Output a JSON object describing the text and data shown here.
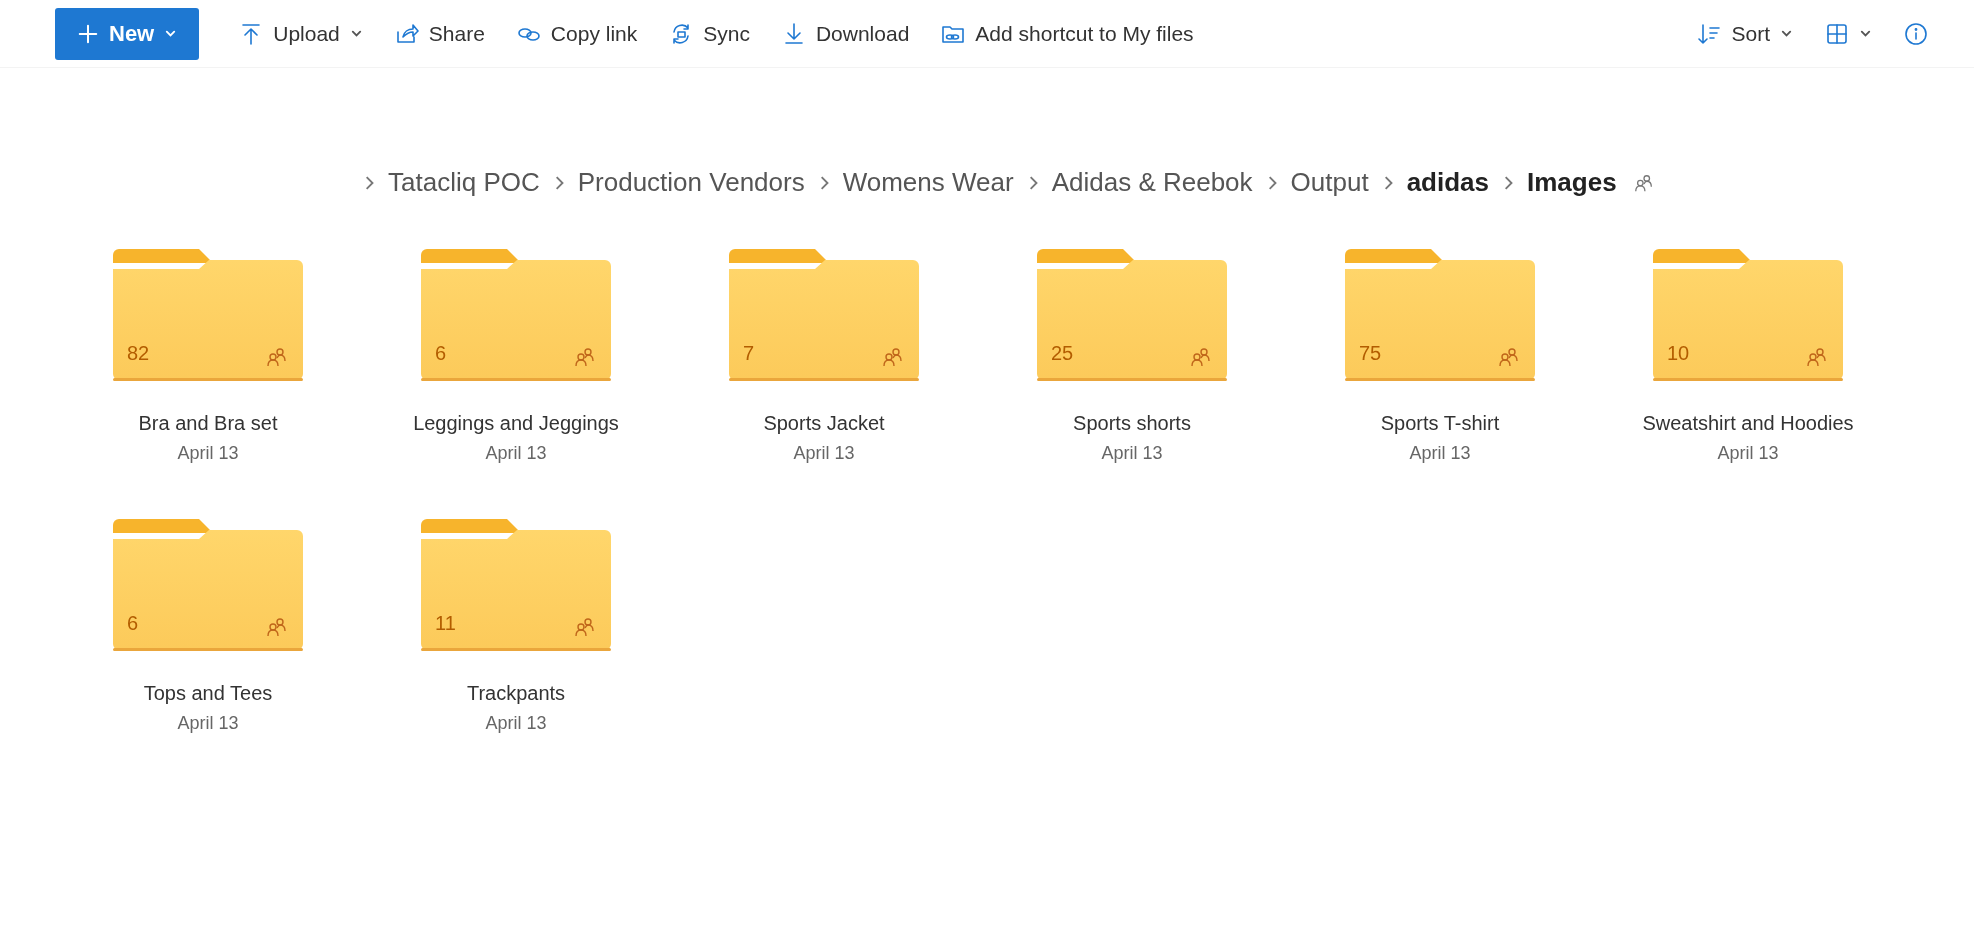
{
  "toolbar": {
    "new_button": {
      "label": "New"
    },
    "actions": [
      {
        "label": "Upload"
      },
      {
        "label": "Share"
      },
      {
        "label": "Copy link"
      },
      {
        "label": "Sync"
      },
      {
        "label": "Download"
      },
      {
        "label": "Add shortcut to My files"
      }
    ],
    "right_actions": [
      {
        "label": "Sort"
      }
    ]
  },
  "breadcrumb": {
    "items": [
      {
        "label": "Tatacliq POC",
        "kind": "ancestor"
      },
      {
        "label": "Production Vendors",
        "kind": "ancestor"
      },
      {
        "label": "Womens Wear",
        "kind": "ancestor"
      },
      {
        "label": "Adidas & Reebok",
        "kind": "ancestor"
      },
      {
        "label": "Output",
        "kind": "ancestor"
      },
      {
        "label": "adidas",
        "kind": "parent"
      },
      {
        "label": "Images",
        "kind": "current"
      }
    ]
  },
  "folders": [
    {
      "name": "Bra and Bra set",
      "date": "April 13",
      "count": "82"
    },
    {
      "name": "Leggings and Jeggings",
      "date": "April 13",
      "count": "6"
    },
    {
      "name": "Sports Jacket",
      "date": "April 13",
      "count": "7"
    },
    {
      "name": "Sports shorts",
      "date": "April 13",
      "count": "25"
    },
    {
      "name": "Sports T-shirt",
      "date": "April 13",
      "count": "75"
    },
    {
      "name": "Sweatshirt and Hoodies",
      "date": "April 13",
      "count": "10"
    },
    {
      "name": "Tops and Tees",
      "date": "April 13",
      "count": "6"
    },
    {
      "name": "Trackpants",
      "date": "April 13",
      "count": "11"
    }
  ]
}
